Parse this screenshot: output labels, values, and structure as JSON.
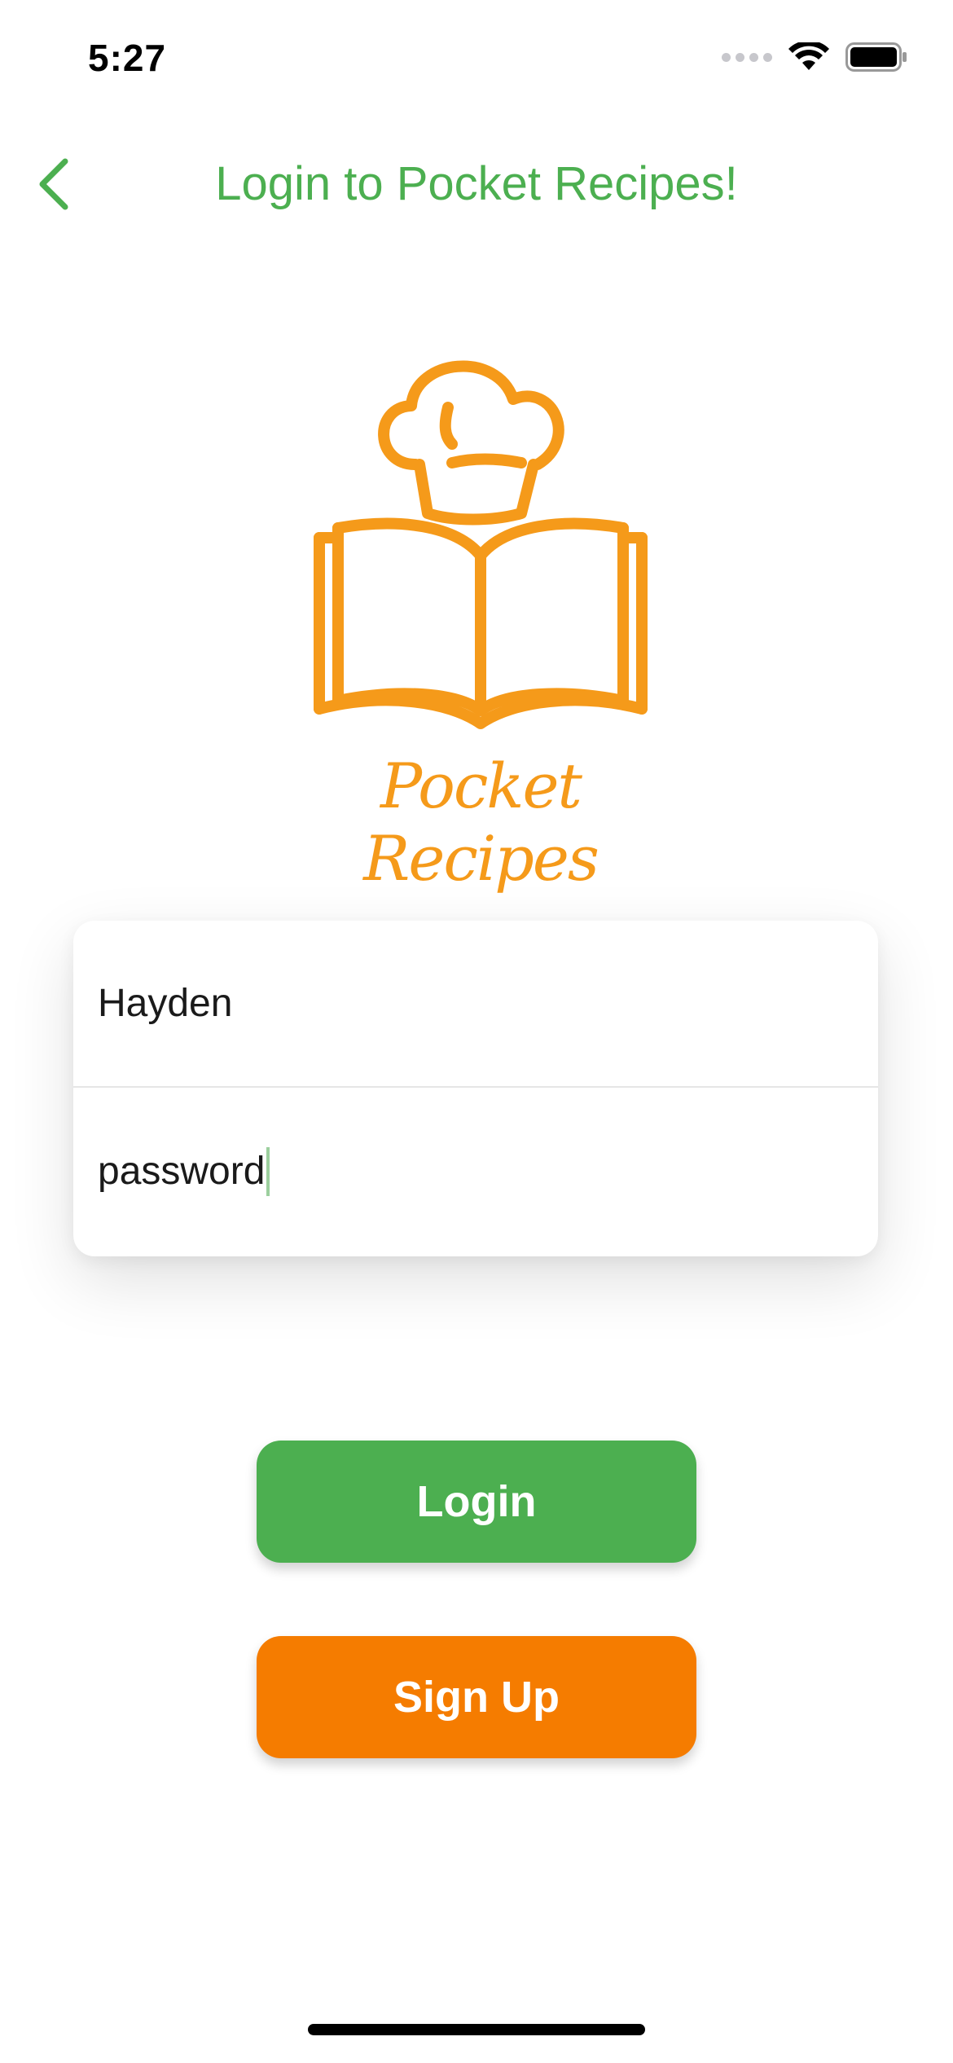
{
  "status_bar": {
    "time": "5:27"
  },
  "header": {
    "back_icon": "chevron-left-icon",
    "title": "Login to Pocket Recipes!"
  },
  "logo": {
    "wordmark": "Pocket Recipes"
  },
  "form": {
    "username_value": "Hayden",
    "password_value": "password"
  },
  "buttons": {
    "login_label": "Login",
    "signup_label": "Sign Up"
  },
  "colors": {
    "primary_green": "#4caf50",
    "accent_orange": "#f57c00",
    "logo_orange": "#f59a1a"
  }
}
